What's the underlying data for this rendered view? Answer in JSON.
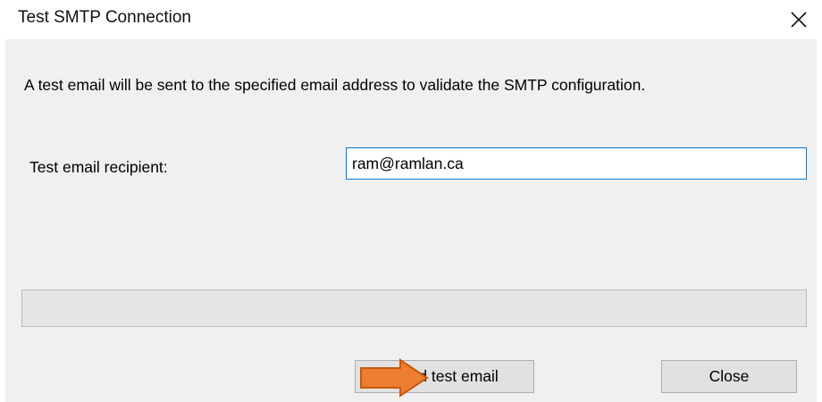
{
  "window": {
    "title": "Test SMTP Connection",
    "close_icon": "close-icon"
  },
  "dialog": {
    "description": "A test email will be sent to the specified email address to validate the SMTP configuration.",
    "recipient_label": "Test email recipient:",
    "recipient_value": "ram@ramlan.ca",
    "progress_percent": 0
  },
  "buttons": {
    "send_label": "Send test email",
    "close_label": "Close"
  },
  "annotation": {
    "arrow_icon": "arrow-right-icon",
    "arrow_color": "#ed7d31",
    "arrow_stroke": "#c55a11"
  },
  "colors": {
    "dialog_background": "#f0f0f0",
    "input_focus_border": "#0078d7",
    "progress_track": "#e6e6e6"
  }
}
